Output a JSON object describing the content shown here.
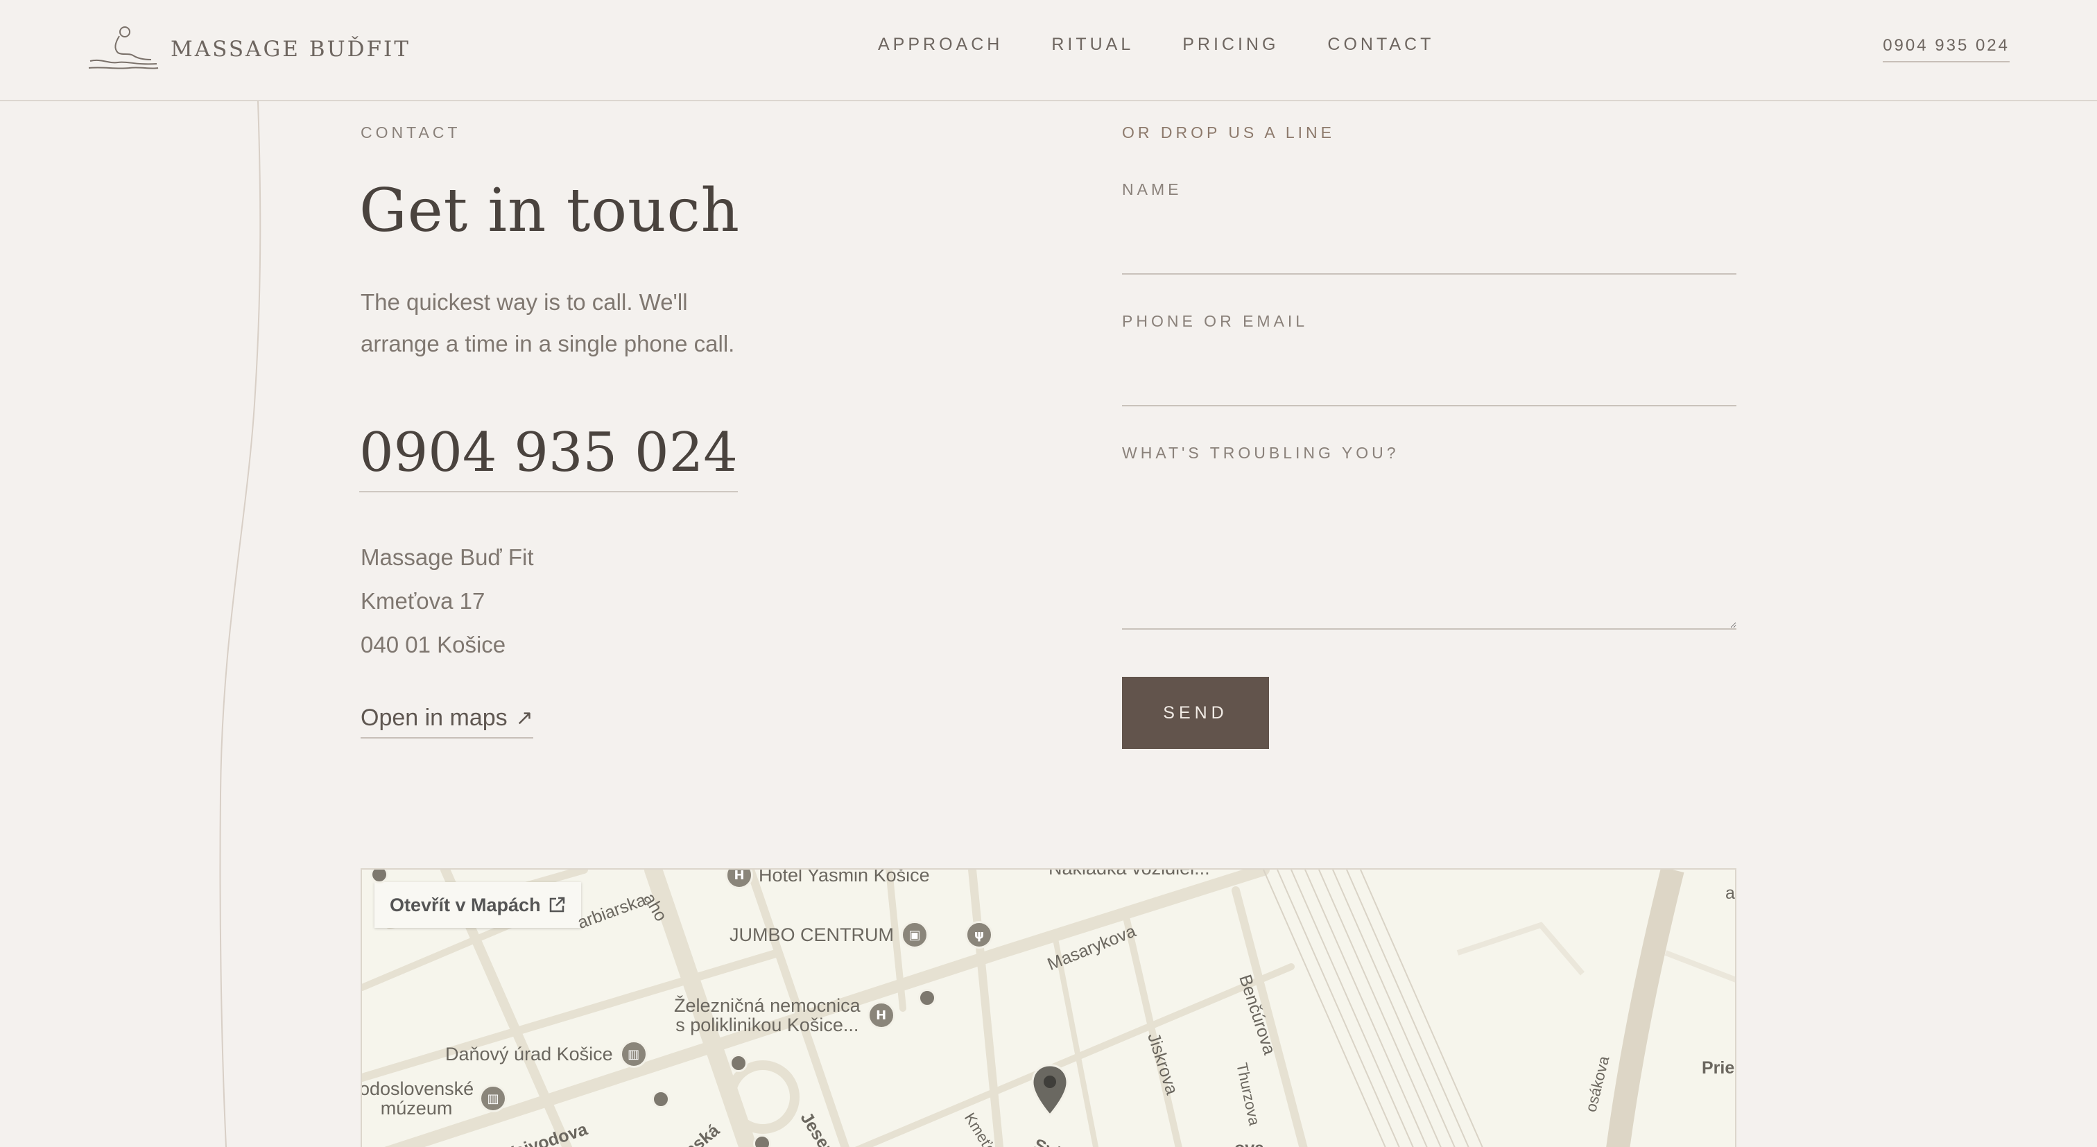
{
  "header": {
    "logo_text": "MASSAGE BUĎFIT",
    "nav": [
      "APPROACH",
      "RITUAL",
      "PRICING",
      "CONTACT"
    ],
    "phone": "0904 935 024"
  },
  "contact": {
    "eyebrow": "CONTACT",
    "title": "Get in touch",
    "lead_line1": "The quickest way is to call. We'll",
    "lead_line2": "arrange a time in a single phone call.",
    "phone": "0904 935 024",
    "address": [
      "Massage Buď Fit",
      "Kmeťova 17",
      "040 01 Košice"
    ],
    "maps_link": "Open in maps",
    "maps_arrow": "↗"
  },
  "form": {
    "eyebrow": "OR DROP US A LINE",
    "name_label": "NAME",
    "name_value": "",
    "contact_label": "PHONE OR EMAIL",
    "contact_value": "",
    "message_label": "WHAT'S TROUBLING YOU?",
    "message_value": "",
    "send_label": "SEND"
  },
  "map": {
    "open_button": "Otevřít v Mapách",
    "pois": {
      "hotel": "Hotel Yasmin Košice",
      "jumbo": "JUMBO CENTRUM",
      "hospital_line1": "Železničná nemocnica",
      "hospital_line2": "s poliklinikou Košice...",
      "tax_office": "Daňový úrad Košice",
      "museum_line1": "odoslovenské",
      "museum_line2": "múzeum",
      "nakladka": "Nakládka vozidiel..."
    },
    "streets": {
      "masarykova": "Masarykova",
      "bencurova": "Benčúrova",
      "jiskrova": "Jiskrova",
      "thurzova": "Thurzova",
      "barbiarska": "arbiarska",
      "aho": "aho",
      "vojvodova": "Vojvodova",
      "kmetova": "Kmeťova",
      "jesenska": "Jesensk",
      "zenska": "enská",
      "prie": "Prie",
      "svaba": "Svä",
      "ova": "ova",
      "osakova": "osákova",
      "a": "a"
    },
    "colors": {
      "land": "#f6f5ec",
      "road": "#e6e1d2",
      "rail": "#d9d3c6",
      "poi": "#8a857a"
    }
  },
  "colors": {
    "background": "#f4f1ee",
    "button": "#62544c",
    "heading": "#4a433e"
  }
}
